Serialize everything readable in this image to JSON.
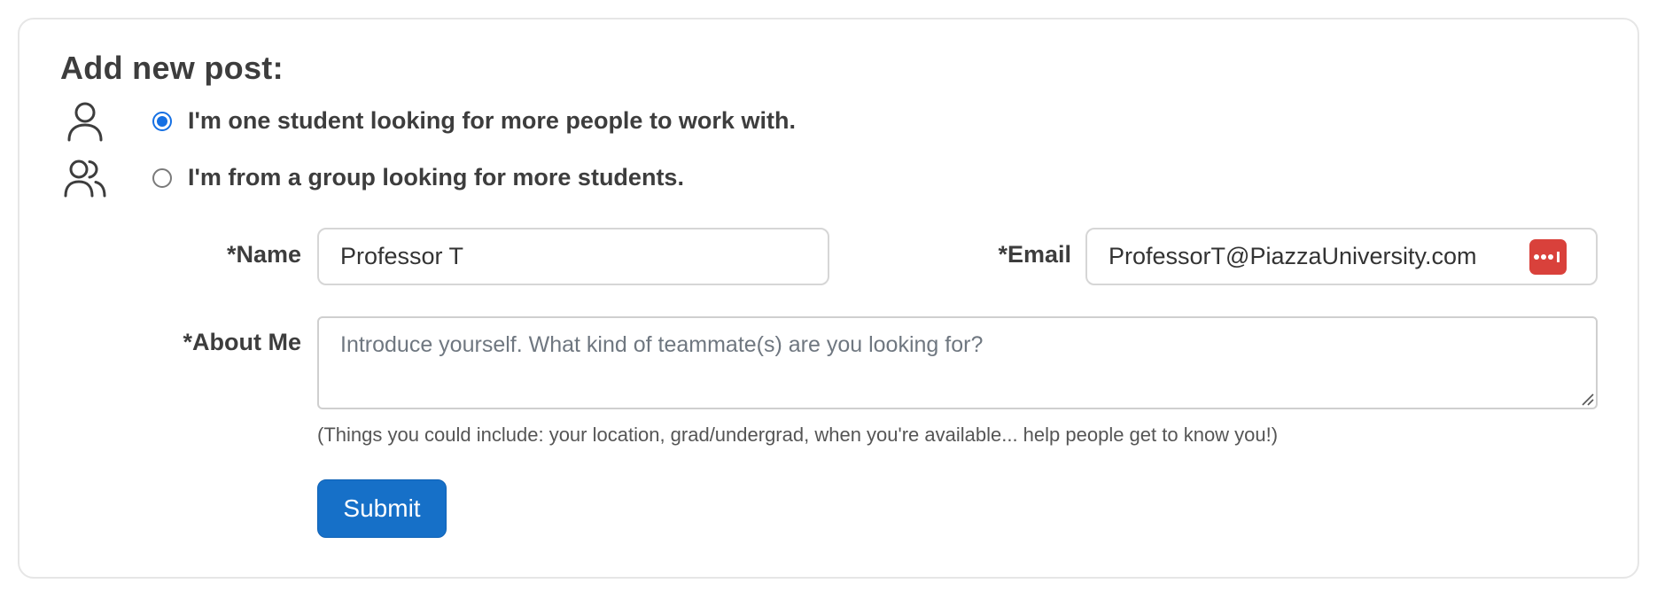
{
  "form": {
    "title": "Add new post:",
    "options": [
      {
        "label": "I'm one student looking for more people to work with.",
        "icon": "person-icon",
        "selected": true
      },
      {
        "label": "I'm from a group looking for more students.",
        "icon": "people-group-icon",
        "selected": false
      }
    ],
    "name": {
      "label": "*Name",
      "value": "Professor T"
    },
    "email": {
      "label": "*Email",
      "value": "ProfessorT@PiazzaUniversity.com",
      "autofill_icon": "password-manager-icon"
    },
    "about": {
      "label": "*About Me",
      "placeholder": "Introduce yourself. What kind of teammate(s) are you looking for?",
      "value": ""
    },
    "hint": "(Things you could include: your location, grad/undergrad, when you're available... help people get to know you!)",
    "submit_label": "Submit"
  },
  "colors": {
    "accent": "#1670c8",
    "radio_selected": "#1570e3",
    "password_manager": "#d9413b",
    "border": "#d6d6d6"
  }
}
